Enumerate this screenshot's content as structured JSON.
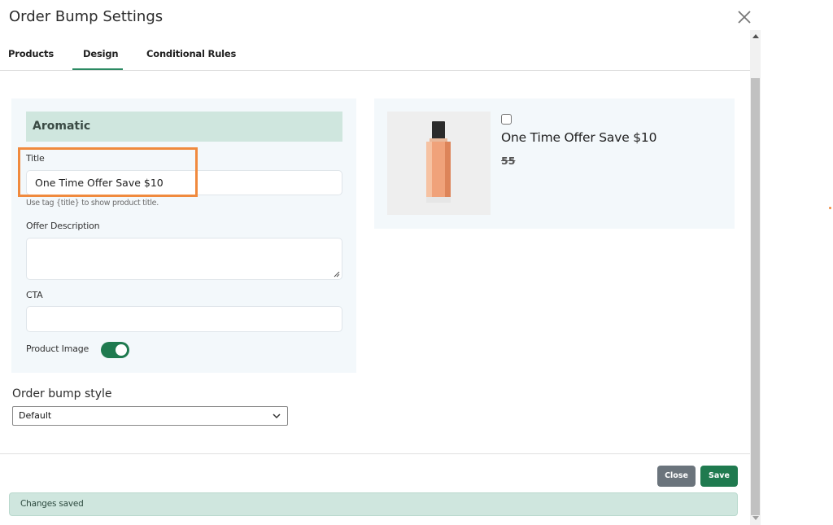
{
  "header": {
    "title": "Order Bump Settings"
  },
  "tabs": [
    {
      "label": "Products"
    },
    {
      "label": "Design"
    },
    {
      "label": "Conditional Rules"
    }
  ],
  "form": {
    "section_title": "Aromatic",
    "title_label": "Title",
    "title_value": "One Time Offer Save $10",
    "title_hint": "Use tag {title} to show product title.",
    "description_label": "Offer Description",
    "description_value": "",
    "cta_label": "CTA",
    "cta_value": "",
    "product_image_label": "Product Image",
    "product_image_enabled": true
  },
  "style": {
    "label": "Order bump style",
    "selected": "Default"
  },
  "preview": {
    "title": "One Time Offer Save $10",
    "price": "55",
    "checked": false,
    "image_icon": "perfume-bottle-icon"
  },
  "footer": {
    "close_label": "Close",
    "save_label": "Save",
    "status_message": "Changes saved"
  },
  "colors": {
    "accent": "#1f7a4f",
    "highlight": "#f08a3e",
    "section_bg": "#cfe6de"
  }
}
